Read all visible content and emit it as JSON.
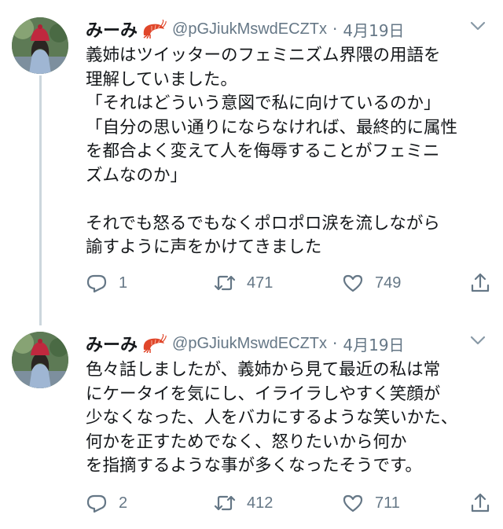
{
  "tweets": [
    {
      "display_name": "みーみ",
      "emoji_icon": "shrimp-emoji",
      "handle": "@pGJiukMswdECZTx",
      "separator": "·",
      "date": "4月19日",
      "text": "義姉はツイッターのフェミニズム界隈の用語を\n理解していました。\n「それはどういう意図で私に向けているのか」\n「自分の思い通りにならなければ、最終的に属性\nを都合よく変えて人を侮辱することがフェミニ\nズムなのか」\n\nそれでも怒るでもなくポロポロ涙を流しながら\n諭すように声をかけてきました",
      "replies": "1",
      "retweets": "471",
      "likes": "749"
    },
    {
      "display_name": "みーみ",
      "emoji_icon": "shrimp-emoji",
      "handle": "@pGJiukMswdECZTx",
      "separator": "·",
      "date": "4月19日",
      "text": "色々話しましたが、義姉から見て最近の私は常\nにケータイを気にし、イライラしやすく笑顔が\n少なくなった、人をバカにするような笑いかた、\n何かを正すためでなく、怒りたいから何か\nを指摘するような事が多くなったそうです。",
      "replies": "2",
      "retweets": "412",
      "likes": "711"
    }
  ],
  "colors": {
    "text": "#14171a",
    "secondary": "#657786",
    "thread_line": "#ccd6dd"
  }
}
